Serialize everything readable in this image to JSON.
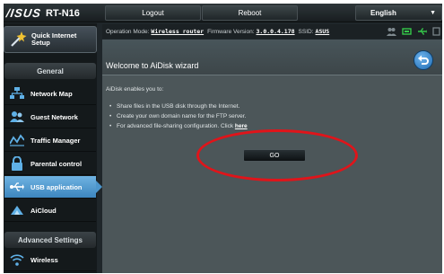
{
  "header": {
    "brand": "/ISUS",
    "model": "RT-N16",
    "logout_label": "Logout",
    "reboot_label": "Reboot",
    "language": "English"
  },
  "sidebar": {
    "quick_setup": "Quick Internet Setup",
    "general_header": "General",
    "items": [
      {
        "label": "Network Map",
        "icon": "network-map-icon"
      },
      {
        "label": "Guest Network",
        "icon": "guest-network-icon"
      },
      {
        "label": "Traffic Manager",
        "icon": "traffic-manager-icon"
      },
      {
        "label": "Parental control",
        "icon": "lock-icon"
      },
      {
        "label": "USB application",
        "icon": "usb-icon",
        "active": true
      },
      {
        "label": "AiCloud",
        "icon": "cloud-icon"
      }
    ],
    "advanced_header": "Advanced Settings",
    "advanced_items": [
      {
        "label": "Wireless",
        "icon": "wireless-icon"
      }
    ]
  },
  "status": {
    "mode_label": "Operation Mode:",
    "mode_value": "Wireless router",
    "firmware_label": "Firmware Version:",
    "firmware_value": "3.0.0.4.178",
    "ssid_label": "SSID:",
    "ssid_value": "ASUS"
  },
  "content": {
    "title": "Welcome to AiDisk wizard",
    "intro": "AiDisk enables you to:",
    "bullets": [
      "Share files in the USB disk through the Internet.",
      "Create your own domain name for the FTP server.",
      "For advanced file-sharing configuration. Click"
    ],
    "link_label": "here",
    "go_label": "GO"
  },
  "colors": {
    "accent": "#4c95cc",
    "annotation": "#e0141a",
    "content_bg": "#4c5659"
  }
}
